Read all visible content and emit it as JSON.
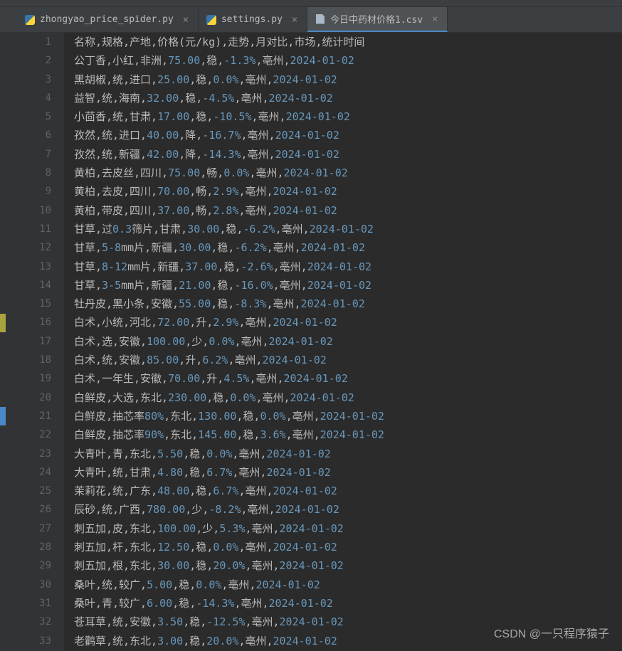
{
  "tabs": [
    {
      "label": "zhongyao_price_spider.py",
      "icon": "py",
      "active": false
    },
    {
      "label": "settings.py",
      "icon": "py",
      "active": false
    },
    {
      "label": "今日中药材价格1.csv",
      "icon": "csv",
      "active": true
    }
  ],
  "header": "名称,规格,产地,价格(元/kg),走势,月对比,市场,统计时间",
  "rows": [
    {
      "n": "公丁香",
      "s": "小红",
      "o": "非洲",
      "p": "75.00",
      "t": "稳",
      "m": "-1.3%",
      "k": "亳州",
      "d": "2024-01-02"
    },
    {
      "n": "黑胡椒",
      "s": "统",
      "o": "进口",
      "p": "25.00",
      "t": "稳",
      "m": "0.0%",
      "k": "亳州",
      "d": "2024-01-02"
    },
    {
      "n": "益智",
      "s": "统",
      "o": "海南",
      "p": "32.00",
      "t": "稳",
      "m": "-4.5%",
      "k": "亳州",
      "d": "2024-01-02"
    },
    {
      "n": "小茴香",
      "s": "统",
      "o": "甘肃",
      "p": "17.00",
      "t": "稳",
      "m": "-10.5%",
      "k": "亳州",
      "d": "2024-01-02"
    },
    {
      "n": "孜然",
      "s": "统",
      "o": "进口",
      "p": "40.00",
      "t": "降",
      "m": "-16.7%",
      "k": "亳州",
      "d": "2024-01-02"
    },
    {
      "n": "孜然",
      "s": "统",
      "o": "新疆",
      "p": "42.00",
      "t": "降",
      "m": "-14.3%",
      "k": "亳州",
      "d": "2024-01-02"
    },
    {
      "n": "黄柏",
      "s": "去皮丝",
      "o": "四川",
      "p": "75.00",
      "t": "畅",
      "m": "0.0%",
      "k": "亳州",
      "d": "2024-01-02"
    },
    {
      "n": "黄柏",
      "s": "去皮",
      "o": "四川",
      "p": "70.00",
      "t": "畅",
      "m": "2.9%",
      "k": "亳州",
      "d": "2024-01-02"
    },
    {
      "n": "黄柏",
      "s": "带皮",
      "o": "四川",
      "p": "37.00",
      "t": "畅",
      "m": "2.8%",
      "k": "亳州",
      "d": "2024-01-02"
    },
    {
      "n": "甘草",
      "s": "过0.3筛片",
      "o": "甘肃",
      "p": "30.00",
      "t": "稳",
      "m": "-6.2%",
      "k": "亳州",
      "d": "2024-01-02"
    },
    {
      "n": "甘草",
      "s": "5-8mm片",
      "o": "新疆",
      "p": "30.00",
      "t": "稳",
      "m": "-6.2%",
      "k": "亳州",
      "d": "2024-01-02"
    },
    {
      "n": "甘草",
      "s": "8-12mm片",
      "o": "新疆",
      "p": "37.00",
      "t": "稳",
      "m": "-2.6%",
      "k": "亳州",
      "d": "2024-01-02"
    },
    {
      "n": "甘草",
      "s": "3-5mm片",
      "o": "新疆",
      "p": "21.00",
      "t": "稳",
      "m": "-16.0%",
      "k": "亳州",
      "d": "2024-01-02"
    },
    {
      "n": "牡丹皮",
      "s": "黑小条",
      "o": "安徽",
      "p": "55.00",
      "t": "稳",
      "m": "-8.3%",
      "k": "亳州",
      "d": "2024-01-02"
    },
    {
      "n": "白术",
      "s": "小统",
      "o": "河北",
      "p": "72.00",
      "t": "升",
      "m": "2.9%",
      "k": "亳州",
      "d": "2024-01-02"
    },
    {
      "n": "白术",
      "s": "选",
      "o": "安徽",
      "p": "100.00",
      "t": "少",
      "m": "0.0%",
      "k": "亳州",
      "d": "2024-01-02"
    },
    {
      "n": "白术",
      "s": "统",
      "o": "安徽",
      "p": "85.00",
      "t": "升",
      "m": "6.2%",
      "k": "亳州",
      "d": "2024-01-02"
    },
    {
      "n": "白术",
      "s": "一年生",
      "o": "安徽",
      "p": "70.00",
      "t": "升",
      "m": "4.5%",
      "k": "亳州",
      "d": "2024-01-02"
    },
    {
      "n": "白鲜皮",
      "s": "大选",
      "o": "东北",
      "p": "230.00",
      "t": "稳",
      "m": "0.0%",
      "k": "亳州",
      "d": "2024-01-02"
    },
    {
      "n": "白鲜皮",
      "s": "抽芯率80%",
      "o": "东北",
      "p": "130.00",
      "t": "稳",
      "m": "0.0%",
      "k": "亳州",
      "d": "2024-01-02"
    },
    {
      "n": "白鲜皮",
      "s": "抽芯率90%",
      "o": "东北",
      "p": "145.00",
      "t": "稳",
      "m": "3.6%",
      "k": "亳州",
      "d": "2024-01-02"
    },
    {
      "n": "大青叶",
      "s": "青",
      "o": "东北",
      "p": "5.50",
      "t": "稳",
      "m": "0.0%",
      "k": "亳州",
      "d": "2024-01-02"
    },
    {
      "n": "大青叶",
      "s": "统",
      "o": "甘肃",
      "p": "4.80",
      "t": "稳",
      "m": "6.7%",
      "k": "亳州",
      "d": "2024-01-02"
    },
    {
      "n": "茉莉花",
      "s": "统",
      "o": "广东",
      "p": "48.00",
      "t": "稳",
      "m": "6.7%",
      "k": "亳州",
      "d": "2024-01-02"
    },
    {
      "n": "辰砂",
      "s": "统",
      "o": "广西",
      "p": "780.00",
      "t": "少",
      "m": "-8.2%",
      "k": "亳州",
      "d": "2024-01-02"
    },
    {
      "n": "刺五加",
      "s": "皮",
      "o": "东北",
      "p": "100.00",
      "t": "少",
      "m": "5.3%",
      "k": "亳州",
      "d": "2024-01-02"
    },
    {
      "n": "刺五加",
      "s": "杆",
      "o": "东北",
      "p": "12.50",
      "t": "稳",
      "m": "0.0%",
      "k": "亳州",
      "d": "2024-01-02"
    },
    {
      "n": "刺五加",
      "s": "根",
      "o": "东北",
      "p": "30.00",
      "t": "稳",
      "m": "20.0%",
      "k": "亳州",
      "d": "2024-01-02"
    },
    {
      "n": "桑叶",
      "s": "统",
      "o": "较广",
      "p": "5.00",
      "t": "稳",
      "m": "0.0%",
      "k": "亳州",
      "d": "2024-01-02"
    },
    {
      "n": "桑叶",
      "s": "青",
      "o": "较广",
      "p": "6.00",
      "t": "稳",
      "m": "-14.3%",
      "k": "亳州",
      "d": "2024-01-02"
    },
    {
      "n": "苍耳草",
      "s": "统",
      "o": "安徽",
      "p": "3.50",
      "t": "稳",
      "m": "-12.5%",
      "k": "亳州",
      "d": "2024-01-02"
    },
    {
      "n": "老鹳草",
      "s": "统",
      "o": "东北",
      "p": "3.00",
      "t": "稳",
      "m": "20.0%",
      "k": "亳州",
      "d": "2024-01-02"
    }
  ],
  "watermark": "CSDN @一只程序猿子"
}
